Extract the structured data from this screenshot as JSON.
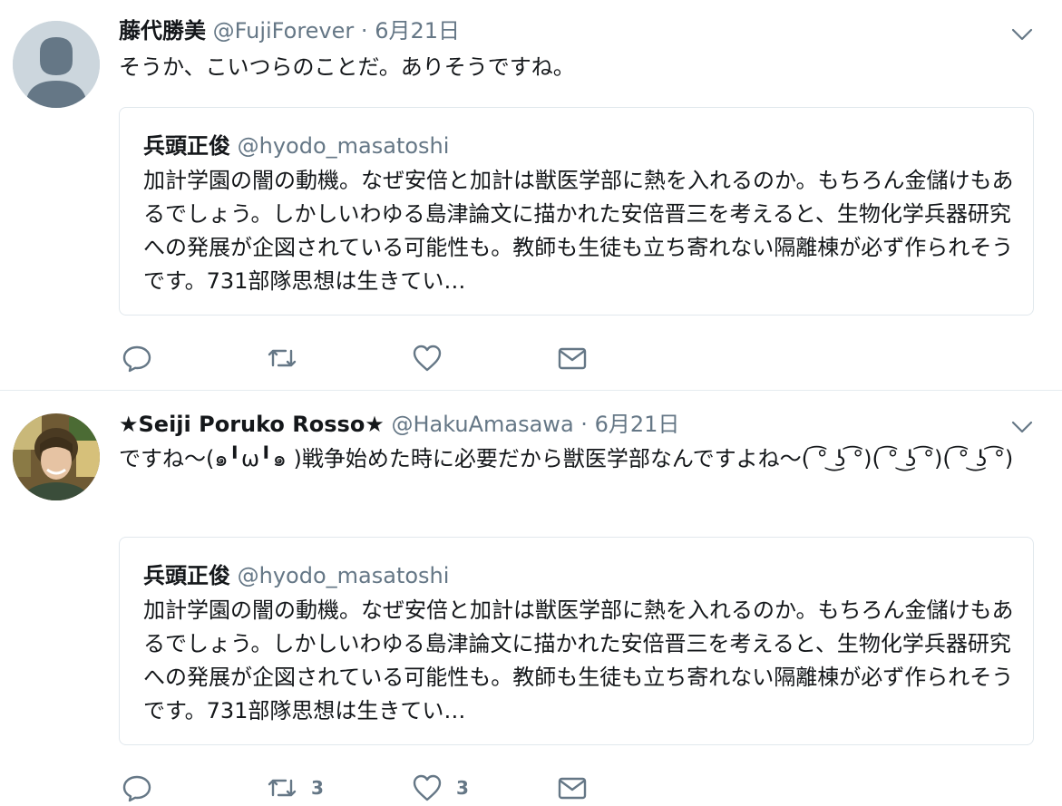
{
  "colors": {
    "text": "#14171a",
    "secondary": "#657786",
    "border": "#e1e8ed",
    "avatar_default": "#ccd6dd"
  },
  "tweets": [
    {
      "user": {
        "name": "藤代勝美",
        "handle": "@FujiForever"
      },
      "separator": "·",
      "date": "6月21日",
      "text": "そうか、こいつらのことだ。ありそうですね。",
      "quote": {
        "name": "兵頭正俊",
        "handle": "@hyodo_masatoshi",
        "text": "加計学園の闇の動機。なぜ安倍と加計は獣医学部に熱を入れるのか。もちろん金儲けもあるでしょう。しかしいわゆる島津論文に描かれた安倍晋三を考えると、生物化学兵器研究への発展が企図されている可能性も。教師も生徒も立ち寄れない隔離棟が必ず作られそうです。731部隊思想は生きてい…"
      },
      "actions": {
        "reply_count": "",
        "retweet_count": "",
        "like_count": ""
      },
      "icons": [
        "reply-icon",
        "retweet-icon",
        "heart-icon",
        "envelope-icon",
        "chevron-down-icon"
      ]
    },
    {
      "user": {
        "name": "★Seiji Poruko Rosso★",
        "handle": "@HakuAmasawa"
      },
      "separator": "·",
      "date": "6月21日",
      "text": "ですね〜(๑╹ω╹๑ )戦争始めた時に必要だから獣医学部なんですよね〜( ͡° ͜ʖ ͡°)( ͡° ͜ʖ ͡°)( ͡° ͜ʖ ͡°)",
      "quote": {
        "name": "兵頭正俊",
        "handle": "@hyodo_masatoshi",
        "text": "加計学園の闇の動機。なぜ安倍と加計は獣医学部に熱を入れるのか。もちろん金儲けもあるでしょう。しかしいわゆる島津論文に描かれた安倍晋三を考えると、生物化学兵器研究への発展が企図されている可能性も。教師も生徒も立ち寄れない隔離棟が必ず作られそうです。731部隊思想は生きてい…"
      },
      "actions": {
        "reply_count": "",
        "retweet_count": "3",
        "like_count": "3"
      },
      "icons": [
        "reply-icon",
        "retweet-icon",
        "heart-icon",
        "envelope-icon",
        "chevron-down-icon"
      ]
    }
  ]
}
